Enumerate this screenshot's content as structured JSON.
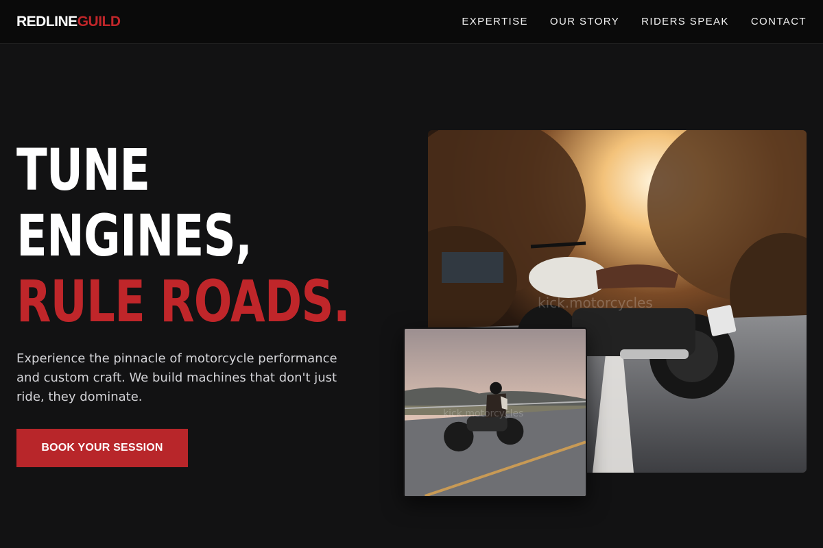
{
  "brand": {
    "part1": "REDLINE",
    "part2": "GUILD",
    "accent": "#c0262a"
  },
  "nav": {
    "items": [
      {
        "label": "EXPERTISE"
      },
      {
        "label": "OUR STORY"
      },
      {
        "label": "RIDERS SPEAK"
      },
      {
        "label": "CONTACT"
      }
    ]
  },
  "hero": {
    "line1": "TUNE",
    "line2": "ENGINES,",
    "line3": "RULE ROADS.",
    "description": "Experience the pinnacle of motorcycle performance and custom craft. We build machines that don't just ride, they dominate.",
    "cta_label": "BOOK YOUR SESSION"
  },
  "images": {
    "main": {
      "subject": "cafe-racer-motorcycle-on-road-sunset",
      "watermark": "kick.motorcycles"
    },
    "inset": {
      "subject": "rider-on-cruiser-motorcycle-highway",
      "watermark": "kick.motorcycles"
    }
  }
}
